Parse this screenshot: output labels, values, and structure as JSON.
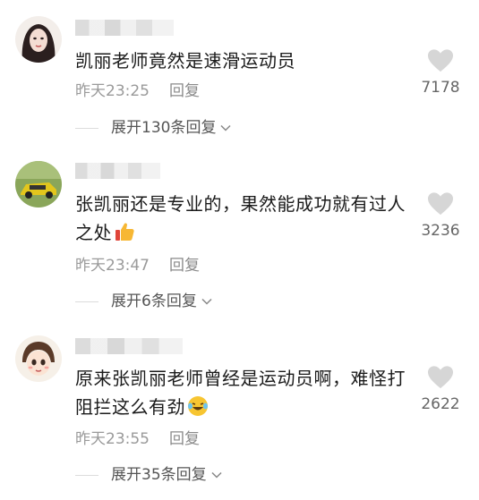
{
  "comments": [
    {
      "text": "凯丽老师竟然是速滑运动员",
      "time": "昨天23:25",
      "reply_label": "回复",
      "likes": "7178",
      "expand_label": "展开130条回复"
    },
    {
      "text": "张凯丽还是专业的，果然能成功就有过人之处",
      "time": "昨天23:47",
      "reply_label": "回复",
      "likes": "3236",
      "expand_label": "展开6条回复",
      "emoji_icon": "thumbs-up-icon"
    },
    {
      "text": "原来张凯丽老师曾经是运动员啊，难怪打阻拦这么有劲",
      "time": "昨天23:55",
      "reply_label": "回复",
      "likes": "2622",
      "expand_label": "展开35条回复",
      "emoji_icon": "laughing-tears-icon"
    }
  ],
  "colors": {
    "text": "#1a1a1a",
    "meta": "#9a9a9a",
    "heart": "#d6d6d6"
  }
}
